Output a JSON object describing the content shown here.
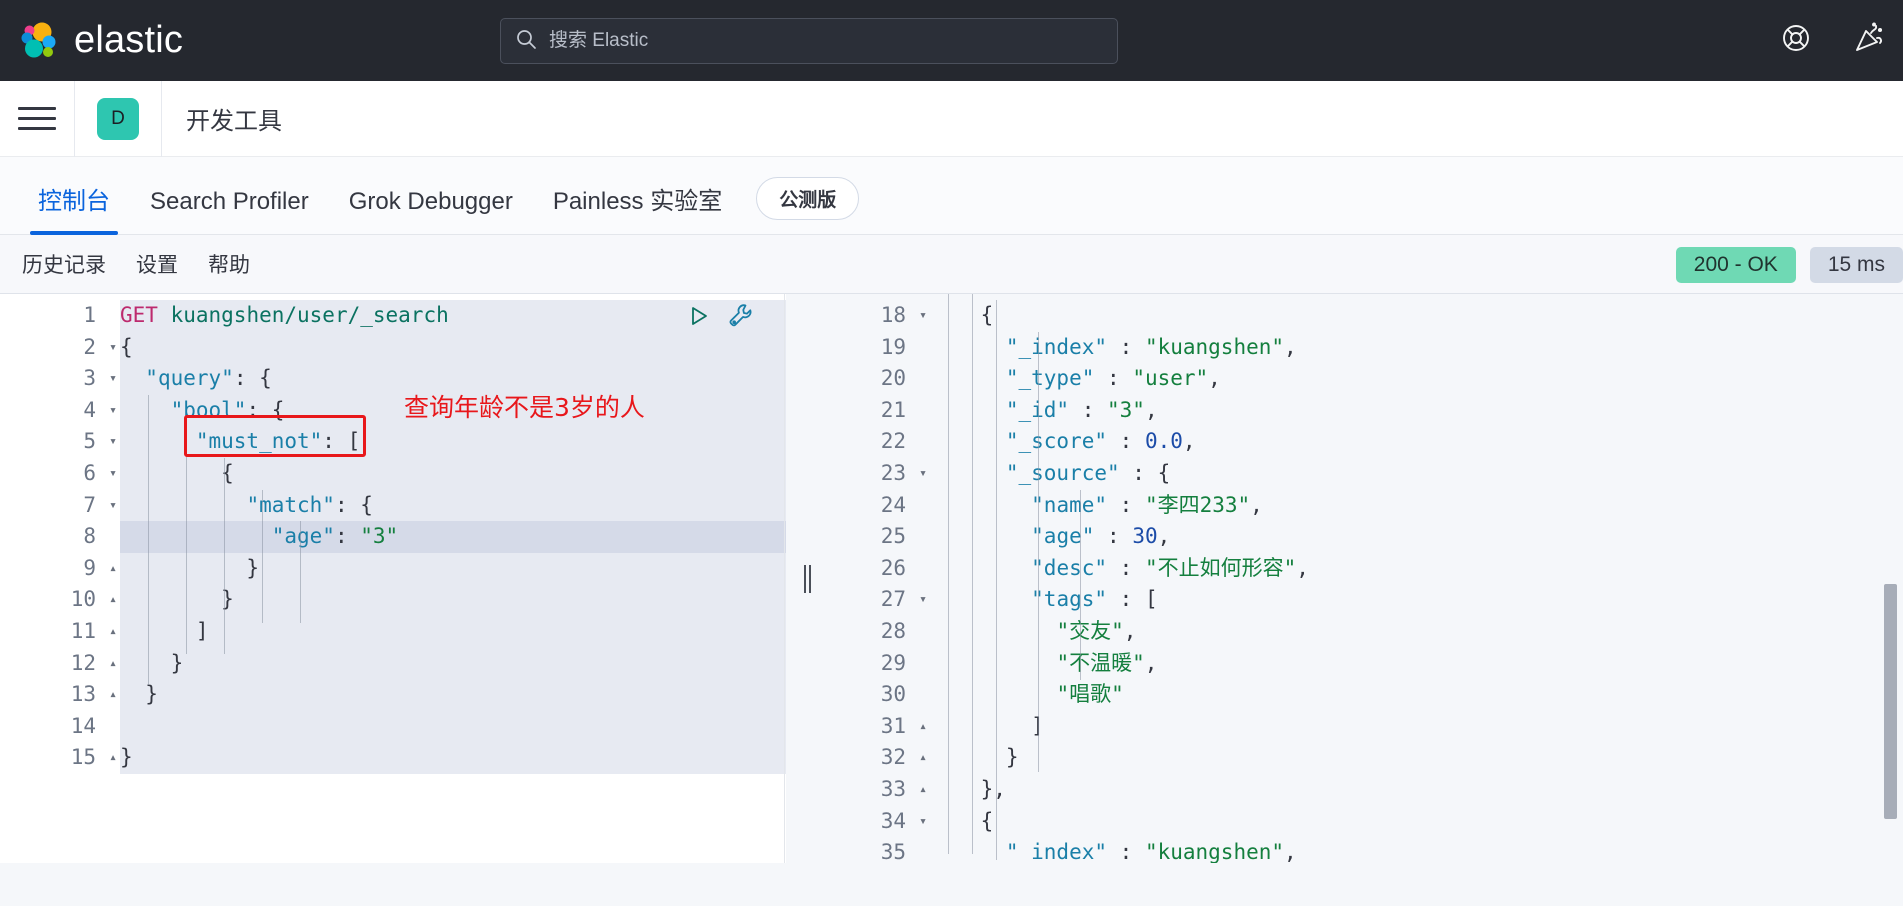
{
  "topbar": {
    "brand_name": "elastic",
    "logo_icon": "elastic-logo-icon",
    "search": {
      "placeholder": "搜索 Elastic",
      "value": "",
      "icon": "search-icon"
    },
    "icons": [
      {
        "name": "help-lifebuoy-icon",
        "label": "帮助"
      },
      {
        "name": "announcement-confetti-icon",
        "label": "新功能"
      }
    ]
  },
  "appheader": {
    "menu_icon": "hamburger-menu-icon",
    "space_avatar_letter": "D",
    "title": "开发工具"
  },
  "tabs": [
    {
      "label": "控制台",
      "active": true
    },
    {
      "label": "Search Profiler",
      "active": false
    },
    {
      "label": "Grok Debugger",
      "active": false
    },
    {
      "label": "Painless 实验室",
      "active": false
    }
  ],
  "beta_pill": "公测版",
  "console_toolbar": {
    "buttons": [
      "历史记录",
      "设置",
      "帮助"
    ],
    "status": "200 - OK",
    "time": "15 ms"
  },
  "request_editor": {
    "play_icon": "play-triangle-icon",
    "wrench_icon": "wrench-icon",
    "lines": [
      {
        "n": 1,
        "fold": "",
        "highlight": false,
        "tokens": [
          {
            "t": "GET",
            "c": "k-method"
          },
          {
            "t": " ",
            "c": "k-punc"
          },
          {
            "t": "kuangshen/user/_search",
            "c": "k-url"
          }
        ]
      },
      {
        "n": 2,
        "fold": "▾",
        "highlight": false,
        "tokens": [
          {
            "t": "{",
            "c": "k-punc"
          }
        ]
      },
      {
        "n": 3,
        "fold": "▾",
        "highlight": false,
        "tokens": [
          {
            "t": "  ",
            "c": "k-punc"
          },
          {
            "t": "\"query\"",
            "c": "k-key"
          },
          {
            "t": ": {",
            "c": "k-punc"
          }
        ]
      },
      {
        "n": 4,
        "fold": "▾",
        "highlight": false,
        "tokens": [
          {
            "t": "    ",
            "c": "k-punc"
          },
          {
            "t": "\"bool\"",
            "c": "k-key"
          },
          {
            "t": ": {",
            "c": "k-punc"
          }
        ]
      },
      {
        "n": 5,
        "fold": "▾",
        "highlight": false,
        "tokens": [
          {
            "t": "      ",
            "c": "k-punc"
          },
          {
            "t": "\"must_not\"",
            "c": "k-key"
          },
          {
            "t": ": [",
            "c": "k-punc"
          }
        ]
      },
      {
        "n": 6,
        "fold": "▾",
        "highlight": false,
        "tokens": [
          {
            "t": "        {",
            "c": "k-punc"
          }
        ]
      },
      {
        "n": 7,
        "fold": "▾",
        "highlight": false,
        "tokens": [
          {
            "t": "          ",
            "c": "k-punc"
          },
          {
            "t": "\"match\"",
            "c": "k-key"
          },
          {
            "t": ": {",
            "c": "k-punc"
          }
        ]
      },
      {
        "n": 8,
        "fold": "",
        "highlight": true,
        "tokens": [
          {
            "t": "            ",
            "c": "k-punc"
          },
          {
            "t": "\"age\"",
            "c": "k-key"
          },
          {
            "t": ": ",
            "c": "k-punc"
          },
          {
            "t": "\"3\"",
            "c": "k-str"
          }
        ]
      },
      {
        "n": 9,
        "fold": "▴",
        "highlight": false,
        "tokens": [
          {
            "t": "          }",
            "c": "k-punc"
          }
        ]
      },
      {
        "n": 10,
        "fold": "▴",
        "highlight": false,
        "tokens": [
          {
            "t": "        }",
            "c": "k-punc"
          }
        ]
      },
      {
        "n": 11,
        "fold": "▴",
        "highlight": false,
        "tokens": [
          {
            "t": "      ]",
            "c": "k-punc"
          }
        ]
      },
      {
        "n": 12,
        "fold": "▴",
        "highlight": false,
        "tokens": [
          {
            "t": "    }",
            "c": "k-punc"
          }
        ]
      },
      {
        "n": 13,
        "fold": "▴",
        "highlight": false,
        "tokens": [
          {
            "t": "  }",
            "c": "k-punc"
          }
        ]
      },
      {
        "n": 14,
        "fold": "",
        "highlight": false,
        "tokens": [
          {
            "t": "",
            "c": "k-punc"
          }
        ]
      },
      {
        "n": 15,
        "fold": "▴",
        "highlight": false,
        "tokens": [
          {
            "t": "}",
            "c": "k-punc"
          }
        ]
      }
    ],
    "annotation": "查询年龄不是3岁的人"
  },
  "response_editor": {
    "lines": [
      {
        "n": 18,
        "fold": "▾",
        "tokens": [
          {
            "t": "    {",
            "c": "k-punc"
          }
        ]
      },
      {
        "n": 19,
        "fold": "",
        "tokens": [
          {
            "t": "      ",
            "c": "k-punc"
          },
          {
            "t": "\"_index\"",
            "c": "k-key"
          },
          {
            "t": " : ",
            "c": "k-punc"
          },
          {
            "t": "\"kuangshen\"",
            "c": "k-str"
          },
          {
            "t": ",",
            "c": "k-punc"
          }
        ]
      },
      {
        "n": 20,
        "fold": "",
        "tokens": [
          {
            "t": "      ",
            "c": "k-punc"
          },
          {
            "t": "\"_type\"",
            "c": "k-key"
          },
          {
            "t": " : ",
            "c": "k-punc"
          },
          {
            "t": "\"user\"",
            "c": "k-str"
          },
          {
            "t": ",",
            "c": "k-punc"
          }
        ]
      },
      {
        "n": 21,
        "fold": "",
        "tokens": [
          {
            "t": "      ",
            "c": "k-punc"
          },
          {
            "t": "\"_id\"",
            "c": "k-key"
          },
          {
            "t": " : ",
            "c": "k-punc"
          },
          {
            "t": "\"3\"",
            "c": "k-str"
          },
          {
            "t": ",",
            "c": "k-punc"
          }
        ]
      },
      {
        "n": 22,
        "fold": "",
        "tokens": [
          {
            "t": "      ",
            "c": "k-punc"
          },
          {
            "t": "\"_score\"",
            "c": "k-key"
          },
          {
            "t": " : ",
            "c": "k-punc"
          },
          {
            "t": "0.0",
            "c": "k-num"
          },
          {
            "t": ",",
            "c": "k-punc"
          }
        ]
      },
      {
        "n": 23,
        "fold": "▾",
        "tokens": [
          {
            "t": "      ",
            "c": "k-punc"
          },
          {
            "t": "\"_source\"",
            "c": "k-key"
          },
          {
            "t": " : {",
            "c": "k-punc"
          }
        ]
      },
      {
        "n": 24,
        "fold": "",
        "tokens": [
          {
            "t": "        ",
            "c": "k-punc"
          },
          {
            "t": "\"name\"",
            "c": "k-key"
          },
          {
            "t": " : ",
            "c": "k-punc"
          },
          {
            "t": "\"李四233\"",
            "c": "k-str"
          },
          {
            "t": ",",
            "c": "k-punc"
          }
        ]
      },
      {
        "n": 25,
        "fold": "",
        "tokens": [
          {
            "t": "        ",
            "c": "k-punc"
          },
          {
            "t": "\"age\"",
            "c": "k-key"
          },
          {
            "t": " : ",
            "c": "k-punc"
          },
          {
            "t": "30",
            "c": "k-num"
          },
          {
            "t": ",",
            "c": "k-punc"
          }
        ]
      },
      {
        "n": 26,
        "fold": "",
        "tokens": [
          {
            "t": "        ",
            "c": "k-punc"
          },
          {
            "t": "\"desc\"",
            "c": "k-key"
          },
          {
            "t": " : ",
            "c": "k-punc"
          },
          {
            "t": "\"不止如何形容\"",
            "c": "k-str"
          },
          {
            "t": ",",
            "c": "k-punc"
          }
        ]
      },
      {
        "n": 27,
        "fold": "▾",
        "tokens": [
          {
            "t": "        ",
            "c": "k-punc"
          },
          {
            "t": "\"tags\"",
            "c": "k-key"
          },
          {
            "t": " : [",
            "c": "k-punc"
          }
        ]
      },
      {
        "n": 28,
        "fold": "",
        "tokens": [
          {
            "t": "          ",
            "c": "k-punc"
          },
          {
            "t": "\"交友\"",
            "c": "k-str"
          },
          {
            "t": ",",
            "c": "k-punc"
          }
        ]
      },
      {
        "n": 29,
        "fold": "",
        "tokens": [
          {
            "t": "          ",
            "c": "k-punc"
          },
          {
            "t": "\"不温暖\"",
            "c": "k-str"
          },
          {
            "t": ",",
            "c": "k-punc"
          }
        ]
      },
      {
        "n": 30,
        "fold": "",
        "tokens": [
          {
            "t": "          ",
            "c": "k-punc"
          },
          {
            "t": "\"唱歌\"",
            "c": "k-str"
          }
        ]
      },
      {
        "n": 31,
        "fold": "▴",
        "tokens": [
          {
            "t": "        ]",
            "c": "k-punc"
          }
        ]
      },
      {
        "n": 32,
        "fold": "▴",
        "tokens": [
          {
            "t": "      }",
            "c": "k-punc"
          }
        ]
      },
      {
        "n": 33,
        "fold": "▴",
        "tokens": [
          {
            "t": "    },",
            "c": "k-punc"
          }
        ]
      },
      {
        "n": 34,
        "fold": "▾",
        "tokens": [
          {
            "t": "    {",
            "c": "k-punc"
          }
        ]
      },
      {
        "n": 35,
        "fold": "",
        "tokens": [
          {
            "t": "      ",
            "c": "k-punc"
          },
          {
            "t": "\"_index\"",
            "c": "k-key"
          },
          {
            "t": " : ",
            "c": "k-punc"
          },
          {
            "t": "\"kuangshen\"",
            "c": "k-str"
          },
          {
            "t": ",",
            "c": "k-punc"
          }
        ]
      }
    ]
  },
  "colors": {
    "topbar_bg": "#25282f",
    "accent_blue": "#0b64dd",
    "space_avatar": "#2ec6b0",
    "status_ok": "#6fd9b4",
    "annotation_red": "#e8171b"
  }
}
